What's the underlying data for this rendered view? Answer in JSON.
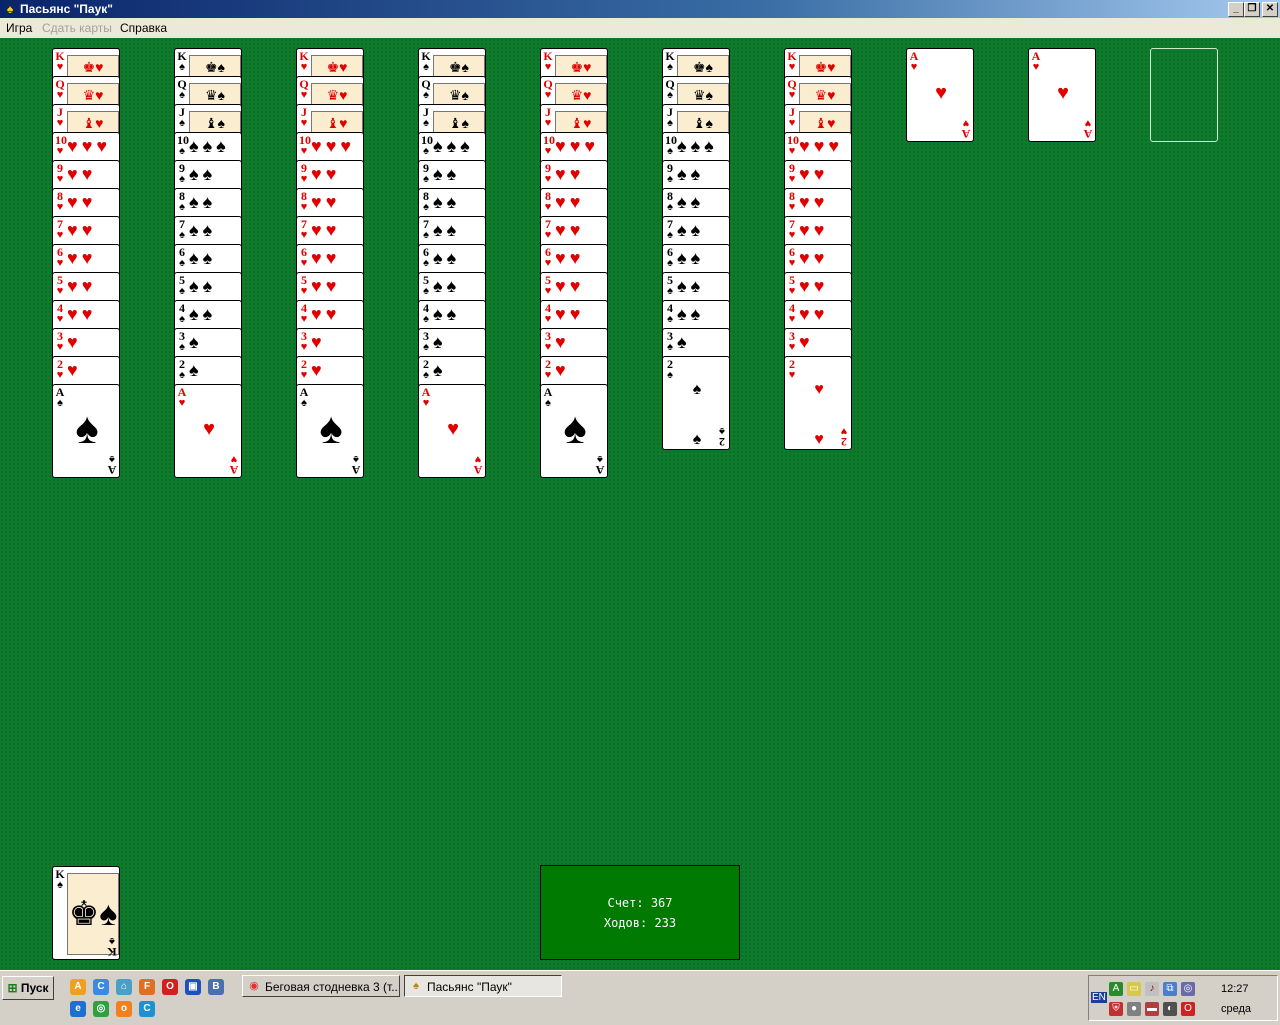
{
  "window": {
    "title": "Пасьянс \"Паук\"",
    "controls": [
      "minimize",
      "restore",
      "close"
    ]
  },
  "menu": {
    "items": [
      {
        "label": "Игра",
        "enabled": true
      },
      {
        "label": "Сдать карты",
        "enabled": false
      },
      {
        "label": "Справка",
        "enabled": true
      }
    ]
  },
  "colors": {
    "felt": "#0e7a2c",
    "red": "#e00000",
    "black": "#000000",
    "score_box": "#007a00"
  },
  "tableau": [
    {
      "suit": "♥",
      "cards": [
        "K",
        "Q",
        "J",
        "10",
        "9",
        "8",
        "7",
        "6",
        "5",
        "4",
        "3",
        "2"
      ],
      "top": {
        "rank": "A",
        "suit": "♠"
      }
    },
    {
      "suit": "♠",
      "cards": [
        "K",
        "Q",
        "J",
        "10",
        "9",
        "8",
        "7",
        "6",
        "5",
        "4",
        "3",
        "2"
      ],
      "top": {
        "rank": "A",
        "suit": "♥"
      }
    },
    {
      "suit": "♥",
      "cards": [
        "K",
        "Q",
        "J",
        "10",
        "9",
        "8",
        "7",
        "6",
        "5",
        "4",
        "3",
        "2"
      ],
      "top": {
        "rank": "A",
        "suit": "♠"
      }
    },
    {
      "suit": "♠",
      "cards": [
        "K",
        "Q",
        "J",
        "10",
        "9",
        "8",
        "7",
        "6",
        "5",
        "4",
        "3",
        "2"
      ],
      "top": {
        "rank": "A",
        "suit": "♥"
      }
    },
    {
      "suit": "♥",
      "cards": [
        "K",
        "Q",
        "J",
        "10",
        "9",
        "8",
        "7",
        "6",
        "5",
        "4",
        "3",
        "2"
      ],
      "top": {
        "rank": "A",
        "suit": "♠"
      }
    },
    {
      "suit": "♠",
      "cards": [
        "K",
        "Q",
        "J",
        "10",
        "9",
        "8",
        "7",
        "6",
        "5",
        "4",
        "3"
      ],
      "top": {
        "rank": "2",
        "suit": "♠"
      }
    },
    {
      "suit": "♥",
      "cards": [
        "K",
        "Q",
        "J",
        "10",
        "9",
        "8",
        "7",
        "6",
        "5",
        "4",
        "3"
      ],
      "top": {
        "rank": "2",
        "suit": "♥"
      }
    }
  ],
  "foundations": [
    {
      "rank": "A",
      "suit": "♥"
    },
    {
      "rank": "A",
      "suit": "♥"
    },
    {
      "empty": true
    }
  ],
  "completed_pile": {
    "rank": "K",
    "suit": "♠"
  },
  "score": {
    "score_label": "Счет:",
    "score_value": "367",
    "moves_label": "Ходов:",
    "moves_value": "233"
  },
  "taskbar": {
    "start_label": "Пуск",
    "quick_launch": [
      "A",
      "C",
      "⌂",
      "F",
      "O",
      "▣",
      "B",
      "e",
      "◎",
      "о",
      "C"
    ],
    "buttons": [
      {
        "label": "Беговая стодневка 3 (т...",
        "icon": "chrome-icon",
        "active": false
      },
      {
        "label": "Пасьянс \"Паук\"",
        "icon": "spider-solitaire-icon",
        "active": true
      }
    ],
    "tray": {
      "lang": "EN",
      "time": "12:27",
      "day": "среда"
    }
  }
}
